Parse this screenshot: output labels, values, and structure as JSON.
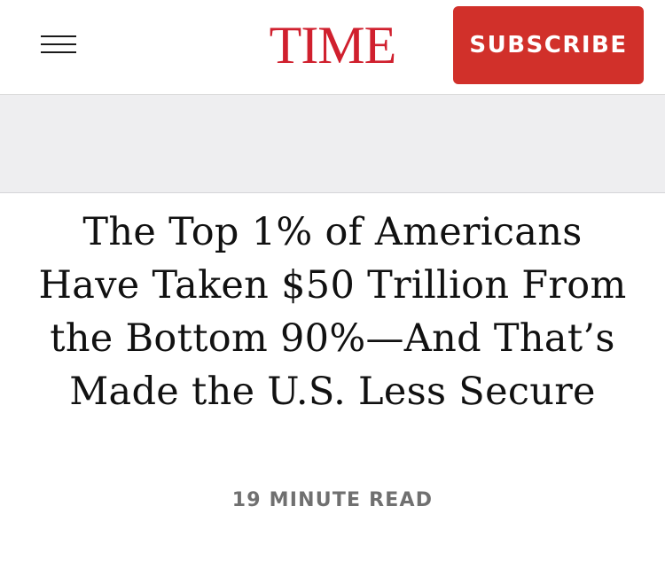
{
  "header": {
    "menu_icon": "hamburger-menu-icon",
    "logo_text": "TIME",
    "subscribe_label": "SUBSCRIBE",
    "brand_color": "#d0202e",
    "subscribe_bg": "#d1302a"
  },
  "article": {
    "headline": "The Top 1% of Americans Have Taken $50 Trillion From the Bottom 90%—And That’s Made the U.S. Less Secure",
    "read_time": "19 MINUTE READ"
  }
}
